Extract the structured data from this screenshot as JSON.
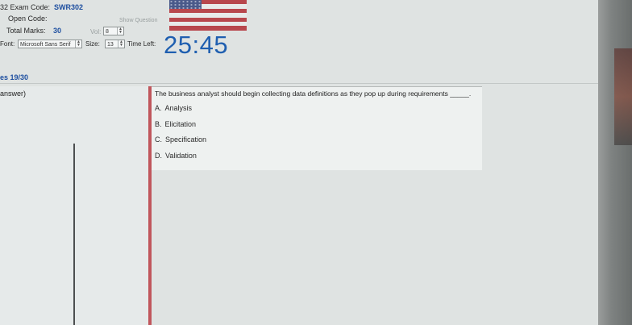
{
  "exam": {
    "exam_code_label": "32 Exam Code:",
    "exam_code_value": "SWR302",
    "open_code_label": "Open Code:",
    "show_question_button": "Show Question",
    "total_marks_label": "Total Marks:",
    "total_marks_value": "30",
    "vol_label": "Vol:",
    "vol_value": "8",
    "font_label": "Font:",
    "font_value": "Microsoft Sans Serif",
    "size_label": "Size:",
    "size_value": "13",
    "time_left_label": "Time Left:",
    "time_left_value": "25:45"
  },
  "progress_text": "es 19/30",
  "answer_panel_label": "answer)",
  "question": {
    "text": "The business analyst should begin collecting data definitions as they pop up during requirements _____.",
    "options": [
      {
        "letter": "A.",
        "text": "Analysis"
      },
      {
        "letter": "B.",
        "text": "Elicitation"
      },
      {
        "letter": "C.",
        "text": "Specification"
      },
      {
        "letter": "D.",
        "text": "Validation"
      }
    ]
  },
  "colors": {
    "accent_blue": "#1f5fb0",
    "highlight_red": "#c0565c",
    "flag_red": "#b8474d",
    "flag_white": "#e8eaea"
  },
  "icons": {
    "flag": "us-flag-icon"
  }
}
